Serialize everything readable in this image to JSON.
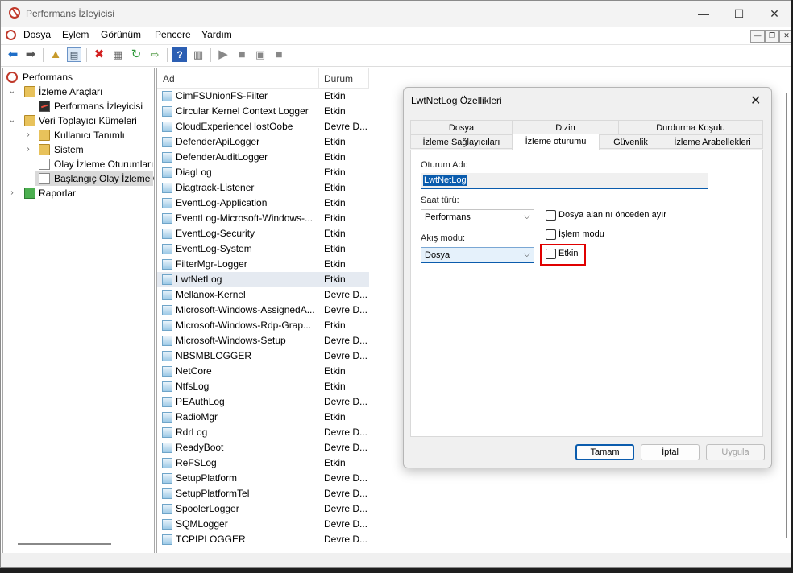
{
  "window": {
    "title": "Performans İzleyicisi",
    "controls": {
      "minimize": "—",
      "maximize": "☐",
      "close": "✕"
    }
  },
  "menubar": {
    "items": [
      "Dosya",
      "Eylem",
      "Görünüm",
      "Pencere",
      "Yardım"
    ],
    "mdi": {
      "minimize": "—",
      "restore": "❐",
      "close": "✕"
    }
  },
  "toolbar": {
    "icons": [
      "back-icon",
      "forward-icon",
      "up-folder-icon",
      "show-hide-tree-icon",
      "delete-icon",
      "properties-icon",
      "refresh-icon",
      "export-icon",
      "help-icon",
      "show-action-pane-icon",
      "start-icon",
      "stop-icon",
      "save-template-icon",
      "stop-all-icon"
    ]
  },
  "tree": {
    "root": "Performans",
    "monitoring_tools": "İzleme Araçları",
    "performance_monitor": "Performans İzleyicisi",
    "data_collector_sets": "Veri Toplayıcı Kümeleri",
    "user_defined": "Kullanıcı Tanımlı",
    "system": "Sistem",
    "event_trace_sessions": "Olay İzleme Oturumları",
    "startup_event_trace": "Başlangıç Olay İzleme O",
    "reports": "Raporlar"
  },
  "list": {
    "columns": {
      "name": "Ad",
      "status": "Durum"
    },
    "rows": [
      {
        "name": "CimFSUnionFS-Filter",
        "status": "Etkin"
      },
      {
        "name": "Circular Kernel Context Logger",
        "status": "Etkin"
      },
      {
        "name": "CloudExperienceHostOobe",
        "status": "Devre D..."
      },
      {
        "name": "DefenderApiLogger",
        "status": "Etkin"
      },
      {
        "name": "DefenderAuditLogger",
        "status": "Etkin"
      },
      {
        "name": "DiagLog",
        "status": "Etkin"
      },
      {
        "name": "Diagtrack-Listener",
        "status": "Etkin"
      },
      {
        "name": "EventLog-Application",
        "status": "Etkin"
      },
      {
        "name": "EventLog-Microsoft-Windows-...",
        "status": "Etkin"
      },
      {
        "name": "EventLog-Security",
        "status": "Etkin"
      },
      {
        "name": "EventLog-System",
        "status": "Etkin"
      },
      {
        "name": "FilterMgr-Logger",
        "status": "Etkin"
      },
      {
        "name": "LwtNetLog",
        "status": "Etkin"
      },
      {
        "name": "Mellanox-Kernel",
        "status": "Devre D..."
      },
      {
        "name": "Microsoft-Windows-AssignedA...",
        "status": "Devre D..."
      },
      {
        "name": "Microsoft-Windows-Rdp-Grap...",
        "status": "Etkin"
      },
      {
        "name": "Microsoft-Windows-Setup",
        "status": "Devre D..."
      },
      {
        "name": "NBSMBLOGGER",
        "status": "Devre D..."
      },
      {
        "name": "NetCore",
        "status": "Etkin"
      },
      {
        "name": "NtfsLog",
        "status": "Etkin"
      },
      {
        "name": "PEAuthLog",
        "status": "Devre D..."
      },
      {
        "name": "RadioMgr",
        "status": "Etkin"
      },
      {
        "name": "RdrLog",
        "status": "Devre D..."
      },
      {
        "name": "ReadyBoot",
        "status": "Devre D..."
      },
      {
        "name": "ReFSLog",
        "status": "Etkin"
      },
      {
        "name": "SetupPlatform",
        "status": "Devre D..."
      },
      {
        "name": "SetupPlatformTel",
        "status": "Devre D..."
      },
      {
        "name": "SpoolerLogger",
        "status": "Devre D..."
      },
      {
        "name": "SQMLogger",
        "status": "Devre D..."
      },
      {
        "name": "TCPIPLOGGER",
        "status": "Devre D..."
      }
    ]
  },
  "dialog": {
    "title": "LwtNetLog Özellikleri",
    "close": "✕",
    "tabs_top": [
      "Dosya",
      "Dizin",
      "Durdurma Koşulu"
    ],
    "tabs_bottom": [
      "İzleme Sağlayıcıları",
      "İzleme oturumu",
      "Güvenlik",
      "İzleme Arabellekleri"
    ],
    "active_tab": "İzleme oturumu",
    "session_name_label": "Oturum Adı:",
    "session_name_value": "LwtNetLog",
    "clock_type_label": "Saat türü:",
    "clock_type_value": "Performans",
    "stream_mode_label": "Akış modu:",
    "stream_mode_value": "Dosya",
    "preallocate_label": "Dosya alanını önceden ayır",
    "preallocate_checked": false,
    "process_mode_label": "İşlem modu",
    "process_mode_checked": false,
    "enabled_label": "Etkin",
    "enabled_checked": false,
    "buttons": {
      "ok": "Tamam",
      "cancel": "İptal",
      "apply": "Uygula"
    },
    "highlight_color": "#e00000"
  },
  "colors": {
    "accent": "#0b5cad",
    "selection": "#d9d9d9"
  }
}
